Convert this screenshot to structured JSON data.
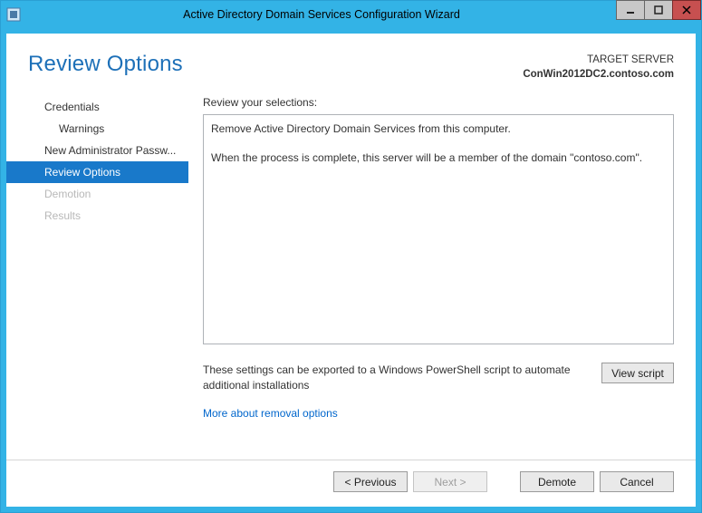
{
  "titlebar": {
    "title": "Active Directory Domain Services Configuration Wizard"
  },
  "header": {
    "page_title": "Review Options",
    "target_label": "TARGET SERVER",
    "target_server": "ConWin2012DC2.contoso.com"
  },
  "sidebar": {
    "items": [
      {
        "label": "Credentials",
        "state": "normal"
      },
      {
        "label": "Warnings",
        "state": "sub"
      },
      {
        "label": "New Administrator Passw...",
        "state": "normal"
      },
      {
        "label": "Review Options",
        "state": "active"
      },
      {
        "label": "Demotion",
        "state": "disabled"
      },
      {
        "label": "Results",
        "state": "disabled"
      }
    ]
  },
  "main": {
    "review_label": "Review your selections:",
    "review_text_line1": "Remove Active Directory Domain Services from this computer.",
    "review_text_line2": "When the process is complete, this server will be a member of the domain \"contoso.com\".",
    "export_text": "These settings can be exported to a Windows PowerShell script to automate additional installations",
    "view_script_label": "View script",
    "more_link": "More about removal options"
  },
  "footer": {
    "previous": "< Previous",
    "next": "Next >",
    "demote": "Demote",
    "cancel": "Cancel"
  }
}
